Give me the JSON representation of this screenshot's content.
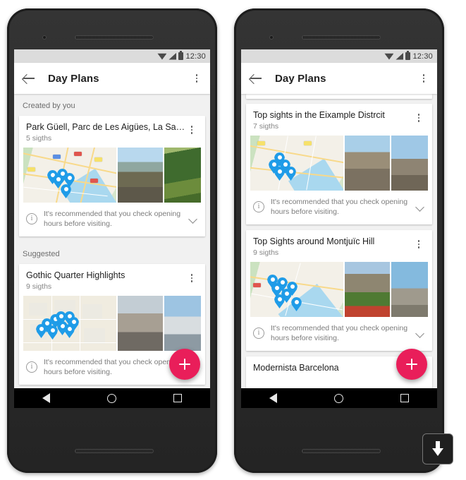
{
  "status_bar": {
    "time": "12:30",
    "icons": [
      "wifi-icon",
      "signal-icon",
      "battery-icon"
    ]
  },
  "app_bar": {
    "title": "Day Plans",
    "back_icon": "back-arrow-icon",
    "overflow_icon": "overflow-menu-icon"
  },
  "colors": {
    "fab": "#e91e5a",
    "pin": "#1f9ce8",
    "statusbar": "#dcdcdc",
    "body_bg": "#f1f1f1"
  },
  "fab": {
    "label": "+",
    "name": "add-day-plan-fab"
  },
  "nav_bar": {
    "back": "back-triangle-icon",
    "home": "home-circle-icon",
    "recents": "recents-square-icon"
  },
  "download_button": {
    "icon": "download-arrow-icon"
  },
  "info_note": "It's recommended that you check opening hours before visiting.",
  "left_phone": {
    "sections": [
      {
        "label": "Created by you",
        "cards": [
          {
            "title": "Park Güell, Parc de Les Aigües, La Sa…",
            "subtitle": "5 sigths",
            "note": "It's recommended that you check opening hours before visiting.",
            "map_pins": 5,
            "photos": [
              "park-guell-view-photo",
              "park-trees-photo",
              "sagrada-familia-photo"
            ]
          }
        ]
      },
      {
        "label": "Suggested",
        "cards": [
          {
            "title": "Gothic Quarter Highlights",
            "subtitle": "9 sigths",
            "note": "It's recommended that you check opening hours before visiting.",
            "map_pins": 9,
            "photos": [
              "gothic-street-photo",
              "christmas-tree-photo",
              "stone-arch-photo"
            ]
          }
        ]
      }
    ]
  },
  "right_phone": {
    "cards": [
      {
        "title": "Top sights in the Eixample Distrcit",
        "subtitle": "7 sigths",
        "note": "It's recommended that you check opening hours before visiting.",
        "map_pins": 5,
        "photos": [
          "barcelona-city-photo",
          "agbar-tower-photo",
          "casa-mila-brick-photo"
        ]
      },
      {
        "title": "Top Sights around Montjuïc Hill",
        "subtitle": "9 sigths",
        "note": "It's recommended that you check opening hours before visiting.",
        "map_pins": 6,
        "photos": [
          "montjuic-castle-photo",
          "cable-car-photo",
          "communications-tower-photo"
        ]
      },
      {
        "title": "Modernista Barcelona",
        "subtitle": "",
        "note": "",
        "map_pins": 0,
        "photos": []
      }
    ]
  }
}
